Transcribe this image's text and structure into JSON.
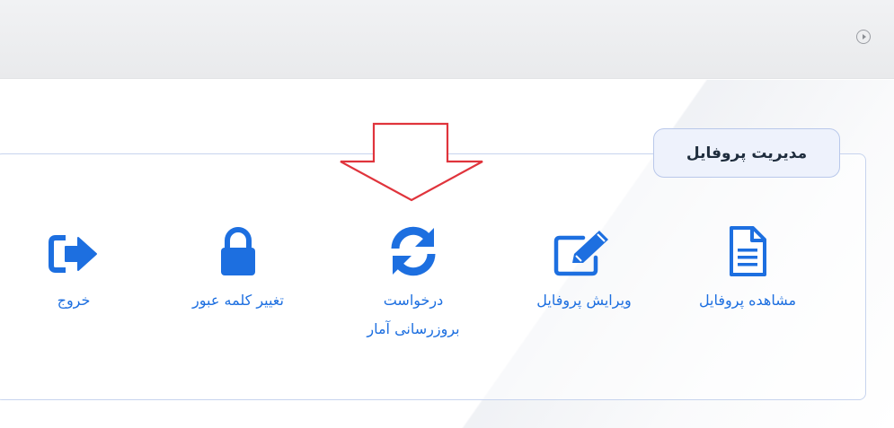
{
  "topbar": {
    "toggle_icon": "circle-arrow-icon"
  },
  "panel": {
    "title": "مدیریت پروفایل"
  },
  "actions": [
    {
      "label": "مشاهده پروفایل",
      "icon": "document-icon"
    },
    {
      "label": "ویرایش پروفایل",
      "icon": "edit-icon"
    },
    {
      "label": "درخواست\nبروزرسانی آمار",
      "icon": "refresh-icon"
    },
    {
      "label": "تغییر کلمه عبور",
      "icon": "lock-icon"
    },
    {
      "label": "خروج",
      "icon": "sign-out-icon"
    }
  ],
  "colors": {
    "accent": "#1d6fe0",
    "annotation_arrow": "#e0343c",
    "panel_border": "#c7d4ee"
  }
}
